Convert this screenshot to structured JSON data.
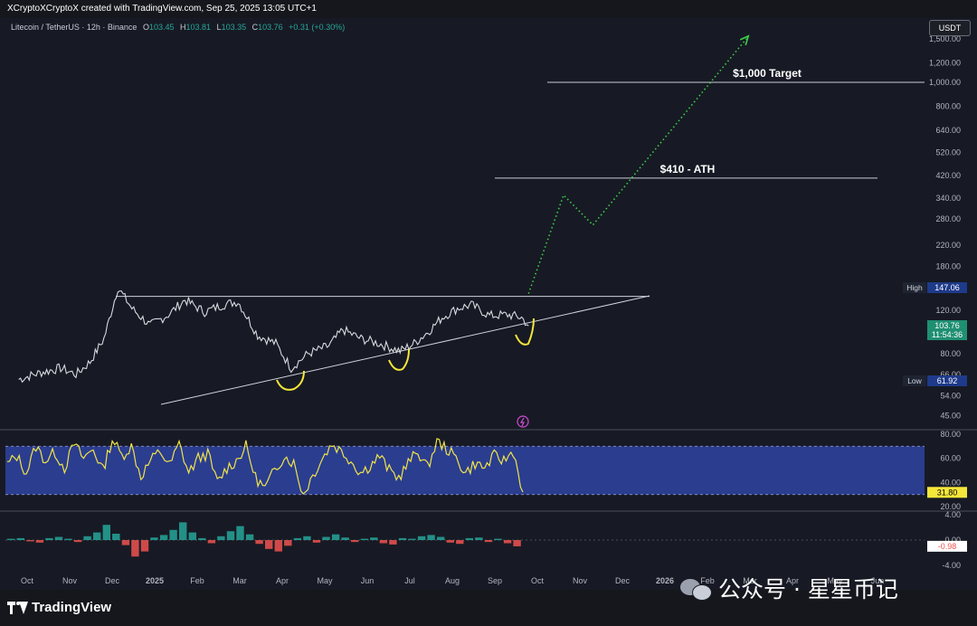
{
  "header": {
    "credit": "XCryptoXCryptoX created with TradingView.com, Sep 25, 2025 13:05 UTC+1"
  },
  "legend": {
    "symbol": "Litecoin / TetherUS · 12h · Binance",
    "open_label": "O",
    "open": "103.45",
    "high_label": "H",
    "high": "103.81",
    "low_label": "L",
    "low": "103.35",
    "close_label": "C",
    "close": "103.76",
    "change": "+0.31 (+0.30%)"
  },
  "currency_button": "USDT",
  "footer": {
    "brand": "TradingView",
    "watermark": "公众号 · 星星币记"
  },
  "colors": {
    "background": "#171a24",
    "price_line": "#d7d9de",
    "rsi_line": "#f0e44a",
    "rsi_band": "#2b3d8f",
    "projection": "#3ecf4a",
    "up": "#26a69a",
    "down": "#ef5350",
    "highlight": "#f5e63a"
  },
  "chart_data": [
    {
      "type": "line",
      "title": "Litecoin / TetherUS · 12h · Binance",
      "scale": "log",
      "ylim": [
        40,
        1600
      ],
      "x_ticks": [
        "Oct",
        "Nov",
        "Dec",
        "2025",
        "Feb",
        "Mar",
        "Apr",
        "May",
        "Jun",
        "Jul",
        "Aug",
        "Sep",
        "Oct",
        "Nov",
        "Dec",
        "2026",
        "Feb",
        "Mar",
        "Apr",
        "May",
        "Jun"
      ],
      "y_ticks": [
        "1,500.00",
        "1,200.00",
        "1,000.00",
        "800.00",
        "640.00",
        "520.00",
        "420.00",
        "340.00",
        "280.00",
        "220.00",
        "180.00",
        "120.00",
        "80.00",
        "66.00",
        "54.00",
        "45.00"
      ],
      "price_series": [
        {
          "x": "2024-09-25",
          "y": 63
        },
        {
          "x": "2024-10-10",
          "y": 67
        },
        {
          "x": "2024-10-25",
          "y": 70
        },
        {
          "x": "2024-11-05",
          "y": 66
        },
        {
          "x": "2024-11-15",
          "y": 74
        },
        {
          "x": "2024-11-25",
          "y": 92
        },
        {
          "x": "2024-12-05",
          "y": 148
        },
        {
          "x": "2024-12-15",
          "y": 122
        },
        {
          "x": "2024-12-28",
          "y": 104
        },
        {
          "x": "2025-01-10",
          "y": 115
        },
        {
          "x": "2025-01-22",
          "y": 132
        },
        {
          "x": "2025-02-05",
          "y": 118
        },
        {
          "x": "2025-02-18",
          "y": 126
        },
        {
          "x": "2025-03-01",
          "y": 130
        },
        {
          "x": "2025-03-15",
          "y": 95
        },
        {
          "x": "2025-03-28",
          "y": 88
        },
        {
          "x": "2025-04-08",
          "y": 70
        },
        {
          "x": "2025-04-20",
          "y": 80
        },
        {
          "x": "2025-05-05",
          "y": 86
        },
        {
          "x": "2025-05-15",
          "y": 100
        },
        {
          "x": "2025-05-28",
          "y": 92
        },
        {
          "x": "2025-06-10",
          "y": 88
        },
        {
          "x": "2025-06-25",
          "y": 82
        },
        {
          "x": "2025-07-05",
          "y": 88
        },
        {
          "x": "2025-07-15",
          "y": 98
        },
        {
          "x": "2025-07-25",
          "y": 112
        },
        {
          "x": "2025-08-05",
          "y": 122
        },
        {
          "x": "2025-08-15",
          "y": 126
        },
        {
          "x": "2025-08-28",
          "y": 114
        },
        {
          "x": "2025-09-10",
          "y": 115
        },
        {
          "x": "2025-09-20",
          "y": 112
        },
        {
          "x": "2025-09-25",
          "y": 103.76
        }
      ],
      "projection": [
        {
          "x": "2025-09-25",
          "y": 140
        },
        {
          "x": "2025-10-20",
          "y": 350
        },
        {
          "x": "2025-11-10",
          "y": 265
        },
        {
          "x": "2026-02-28",
          "y": 1500
        }
      ],
      "levels": [
        {
          "label": "$1,000 Target",
          "y": 1000
        },
        {
          "label": "$410 - ATH",
          "y": 410
        }
      ],
      "annotations": {
        "high_label": "High",
        "high_value": "147.06",
        "low_label": "Low",
        "low_value": "61.92",
        "last_price": "103.76",
        "countdown": "11:54:36"
      }
    },
    {
      "type": "line",
      "name": "RSI",
      "ylim": [
        20,
        80
      ],
      "y_ticks": [
        "80.00",
        "60.00",
        "40.00",
        "20.00"
      ],
      "band": [
        30,
        70
      ],
      "last_value": "31.80",
      "values": [
        55,
        62,
        48,
        70,
        58,
        65,
        52,
        72,
        60,
        68,
        50,
        76,
        62,
        70,
        45,
        58,
        66,
        54,
        72,
        48,
        60,
        64,
        40,
        52,
        58,
        70,
        44,
        35,
        50,
        62,
        56,
        30,
        46,
        60,
        72,
        66,
        58,
        48,
        54,
        62,
        50,
        44,
        56,
        66,
        52,
        74,
        68,
        60,
        48,
        56,
        52,
        62,
        58,
        66,
        32
      ]
    },
    {
      "type": "bar",
      "name": "Histogram",
      "ylim": [
        -4,
        4
      ],
      "y_ticks": [
        "4.00",
        "0.00",
        "-4.00"
      ],
      "last_value": "-0.98",
      "values": [
        0.2,
        0.3,
        -0.2,
        -0.4,
        0.3,
        0.5,
        0.2,
        -0.3,
        0.6,
        1.2,
        2.4,
        1.0,
        -0.8,
        -2.6,
        -1.8,
        0.4,
        0.8,
        1.6,
        2.8,
        1.2,
        0.3,
        -0.5,
        0.6,
        1.4,
        2.2,
        0.9,
        -0.6,
        -1.4,
        -1.8,
        -0.9,
        0.3,
        0.6,
        -0.4,
        0.5,
        0.9,
        0.4,
        -0.3,
        0.2,
        0.4,
        -0.5,
        -0.7,
        0.3,
        0.2,
        0.6,
        0.8,
        0.5,
        -0.4,
        -0.6,
        0.3,
        0.4,
        -0.3,
        0.2,
        -0.5,
        -0.98
      ]
    }
  ]
}
